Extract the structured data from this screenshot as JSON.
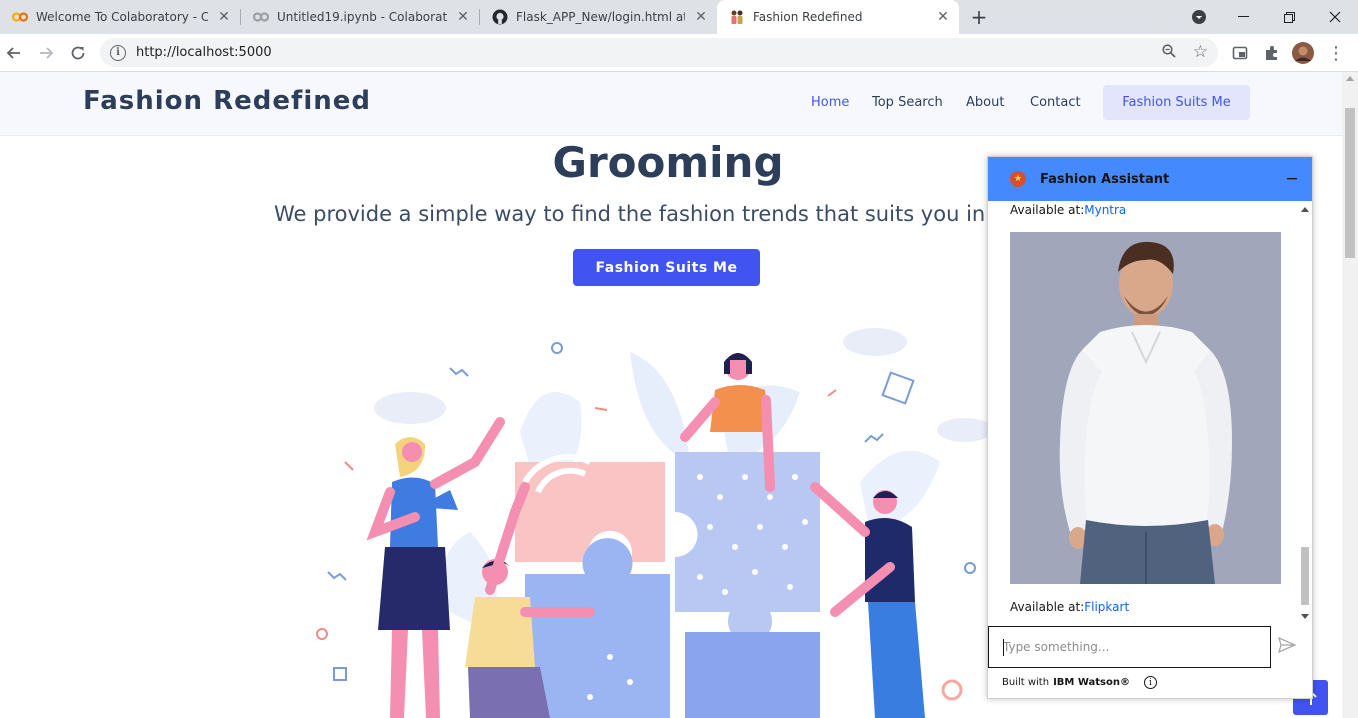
{
  "browser": {
    "tabs": [
      {
        "title": "Welcome To Colaboratory - Cola",
        "icon": "colab-icon"
      },
      {
        "title": "Untitled19.ipynb - Colaboratory",
        "icon": "colab-icon"
      },
      {
        "title": "Flask_APP_New/login.html at ma",
        "icon": "github-icon"
      },
      {
        "title": "Fashion Redefined",
        "icon": "site-favicon",
        "active": true
      }
    ],
    "url": "http://localhost:5000"
  },
  "header": {
    "logo": "Fashion Redefined",
    "nav": [
      "Home",
      "Top Search",
      "About",
      "Contact"
    ],
    "cta": "Fashion Suits Me"
  },
  "hero": {
    "title": "Grooming",
    "subtitle": "We provide a simple way to find the fashion trends that suits you in fin",
    "button": "Fashion Suits Me"
  },
  "chat": {
    "title": "Fashion Assistant",
    "messages": [
      {
        "prefix": "Available at:",
        "link": "Myntra"
      },
      {
        "prefix": "Available at:",
        "link": "Flipkart"
      }
    ],
    "input_placeholder": "Type something...",
    "footer_prefix": "Built with",
    "footer_brand": "IBM Watson®"
  },
  "colors": {
    "accent": "#4154f1",
    "header_bg": "#f6f8fd",
    "chat_header": "#4589ff",
    "text_dark": "#2c3e5a"
  }
}
